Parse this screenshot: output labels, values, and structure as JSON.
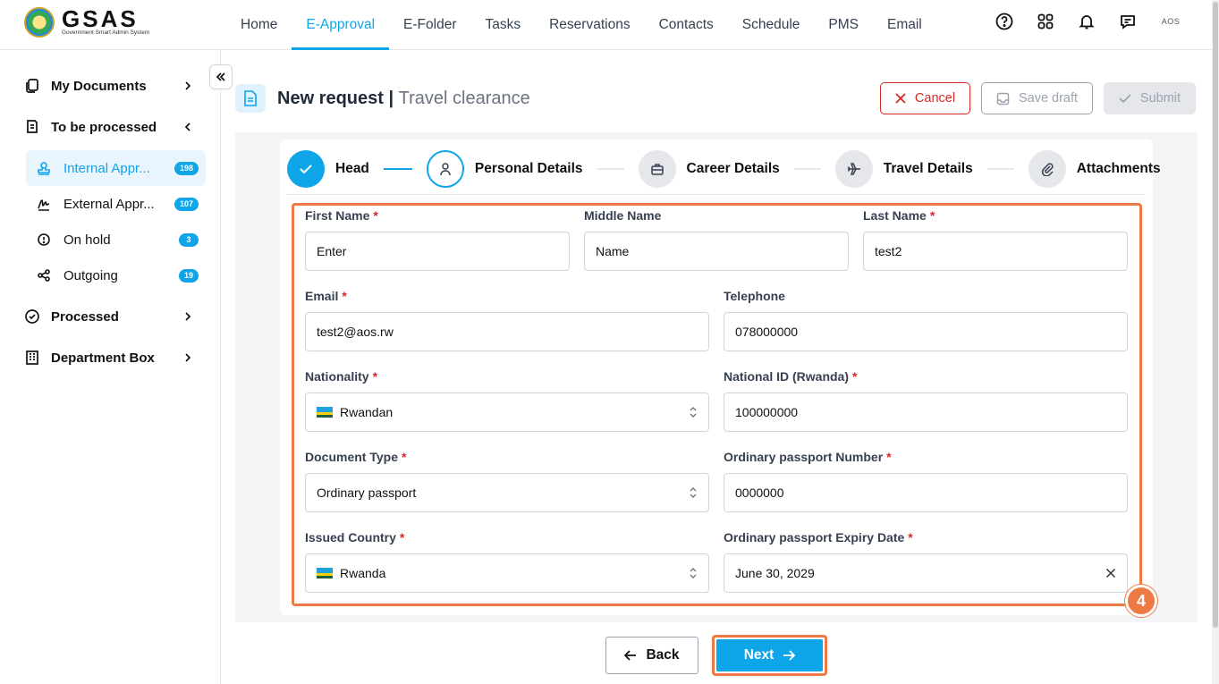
{
  "app": {
    "name": "GSAS",
    "subtitle": "Government Smart Admin System"
  },
  "nav": {
    "items": [
      "Home",
      "E-Approval",
      "E-Folder",
      "Tasks",
      "Reservations",
      "Contacts",
      "Schedule",
      "PMS",
      "Email"
    ],
    "active": "E-Approval"
  },
  "top_icons": {
    "user_label": "AOS"
  },
  "sidebar": {
    "my_documents": "My Documents",
    "to_be_processed": "To be processed",
    "sub": [
      {
        "label": "Internal Appr...",
        "count": "198"
      },
      {
        "label": "External Appr...",
        "count": "107"
      },
      {
        "label": "On hold",
        "count": "3"
      },
      {
        "label": "Outgoing",
        "count": "19"
      }
    ],
    "processed": "Processed",
    "department_box": "Department Box"
  },
  "page": {
    "title": "New request",
    "separator": "|",
    "subtitle": "Travel clearance"
  },
  "actions": {
    "cancel": "Cancel",
    "save_draft": "Save draft",
    "submit": "Submit"
  },
  "steps": [
    "Head",
    "Personal Details",
    "Career Details",
    "Travel Details",
    "Attachments"
  ],
  "form": {
    "first_name": {
      "label": "First Name",
      "value": "Enter"
    },
    "middle_name": {
      "label": "Middle Name",
      "value": "Name"
    },
    "last_name": {
      "label": "Last Name",
      "value": "test2"
    },
    "email": {
      "label": "Email",
      "value": "test2@aos.rw"
    },
    "telephone": {
      "label": "Telephone",
      "value": "078000000"
    },
    "nationality": {
      "label": "Nationality",
      "value": "Rwandan"
    },
    "national_id": {
      "label": "National ID (Rwanda)",
      "value": "100000000"
    },
    "document_type": {
      "label": "Document Type",
      "value": "Ordinary passport"
    },
    "passport_number": {
      "label": "Ordinary passport Number",
      "value": "0000000"
    },
    "issued_country": {
      "label": "Issued Country",
      "value": "Rwanda"
    },
    "expiry_date": {
      "label": "Ordinary passport Expiry Date",
      "value": "June 30, 2029"
    },
    "required_mark": "*"
  },
  "annotation": {
    "step_number": "4"
  },
  "footer": {
    "back": "Back",
    "next": "Next"
  },
  "colors": {
    "accent": "#0ea5e9",
    "danger": "#dc2626",
    "highlight": "#ed7a45"
  }
}
